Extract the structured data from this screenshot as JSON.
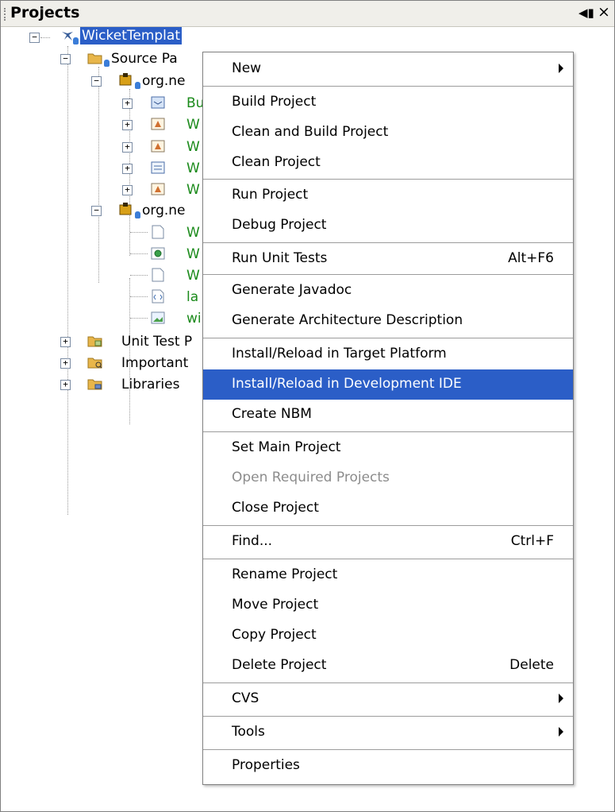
{
  "panel": {
    "title": "Projects"
  },
  "tree": {
    "root": "WicketTemplat",
    "source_packages": "Source Pa",
    "pkg1": "org.ne",
    "pkg1_items": [
      "Bu",
      "W",
      "W",
      "W",
      "W"
    ],
    "pkg2": "org.ne",
    "pkg2_items": [
      "W",
      "W",
      "W",
      "la",
      "wi"
    ],
    "unit_test": "Unit Test P",
    "important": "Important",
    "libraries": "Libraries"
  },
  "menu": {
    "items": [
      {
        "label": "New",
        "submenu": true
      },
      {
        "label": "Build Project"
      },
      {
        "label": "Clean and Build Project"
      },
      {
        "label": "Clean Project"
      },
      {
        "label": "Run Project"
      },
      {
        "label": "Debug Project"
      },
      {
        "label": "Run Unit Tests",
        "shortcut": "Alt+F6"
      },
      {
        "label": "Generate Javadoc"
      },
      {
        "label": "Generate Architecture Description"
      },
      {
        "label": "Install/Reload in Target Platform"
      },
      {
        "label": "Install/Reload in Development IDE",
        "selected": true
      },
      {
        "label": "Create NBM"
      },
      {
        "label": "Set Main Project"
      },
      {
        "label": "Open Required Projects",
        "disabled": true
      },
      {
        "label": "Close Project"
      },
      {
        "label": "Find...",
        "shortcut": "Ctrl+F"
      },
      {
        "label": "Rename Project"
      },
      {
        "label": "Move Project"
      },
      {
        "label": "Copy Project"
      },
      {
        "label": "Delete Project",
        "shortcut": "Delete"
      },
      {
        "label": "CVS",
        "submenu": true
      },
      {
        "label": "Tools",
        "submenu": true
      },
      {
        "label": "Properties"
      }
    ]
  },
  "colors": {
    "selection": "#2b5ec7",
    "green_text": "#1a8a1a",
    "disabled": "#8c8c8c"
  }
}
